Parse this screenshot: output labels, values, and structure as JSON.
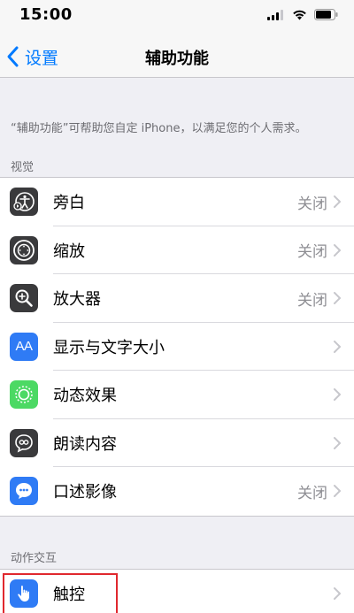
{
  "status_bar": {
    "time": "15:00"
  },
  "nav": {
    "back_label": "设置",
    "title": "辅助功能"
  },
  "description": "“辅助功能”可帮助您自定 iPhone，以满足您的个人需求。",
  "sections": {
    "vision": {
      "header": "视觉",
      "items": [
        {
          "label": "旁白",
          "value": "关闭",
          "icon": "voiceover-icon"
        },
        {
          "label": "缩放",
          "value": "关闭",
          "icon": "zoom-icon"
        },
        {
          "label": "放大器",
          "value": "关闭",
          "icon": "magnifier-icon"
        },
        {
          "label": "显示与文字大小",
          "value": "",
          "icon": "text-size-icon",
          "icon_text": "AA"
        },
        {
          "label": "动态效果",
          "value": "",
          "icon": "motion-icon"
        },
        {
          "label": "朗读内容",
          "value": "",
          "icon": "spoken-content-icon"
        },
        {
          "label": "口述影像",
          "value": "关闭",
          "icon": "audio-description-icon"
        }
      ]
    },
    "interaction": {
      "header": "动作交互",
      "items": [
        {
          "label": "触控",
          "value": "",
          "icon": "touch-icon"
        }
      ]
    }
  },
  "colors": {
    "accent": "#007aff",
    "highlight": "#e0282e",
    "icon_dark": "#3a3a3c",
    "icon_blue": "#2f7bf5",
    "icon_green": "#4cd964"
  }
}
